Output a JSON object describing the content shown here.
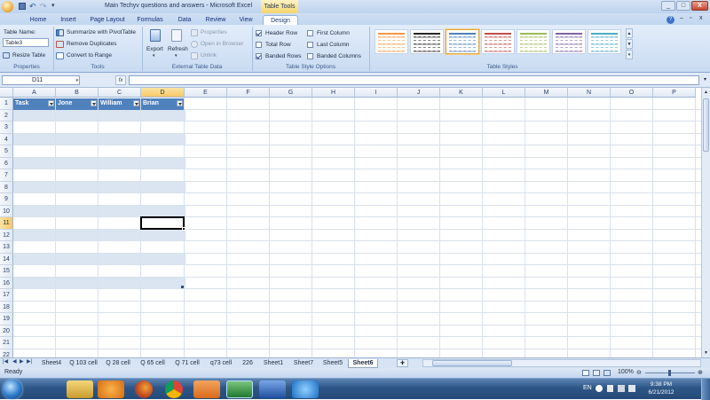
{
  "window": {
    "title": "Main Techyv questions and answers - Microsoft Excel",
    "context_tab": "Table Tools",
    "controls": [
      "_",
      "□",
      "X"
    ]
  },
  "ribbon_tabs": [
    "Home",
    "Insert",
    "Page Layout",
    "Formulas",
    "Data",
    "Review",
    "View",
    "Design"
  ],
  "active_tab": "Design",
  "properties": {
    "table_name_label": "Table Name:",
    "table_name_value": "Table3",
    "resize_label": "Resize Table",
    "group_label": "Properties"
  },
  "tools": {
    "summarize": "Summarize with PivotTable",
    "remove_duplicates": "Remove Duplicates",
    "convert": "Convert to Range",
    "group_label": "Tools"
  },
  "external": {
    "export": "Export",
    "refresh": "Refresh",
    "properties": "Properties",
    "open_browser": "Open in Browser",
    "unlink": "Unlink",
    "group_label": "External Table Data"
  },
  "style_options": {
    "header_row": {
      "label": "Header Row",
      "checked": true
    },
    "total_row": {
      "label": "Total Row",
      "checked": false
    },
    "banded_rows": {
      "label": "Banded Rows",
      "checked": true
    },
    "first_column": {
      "label": "First Column",
      "checked": false
    },
    "last_column": {
      "label": "Last Column",
      "checked": false
    },
    "banded_columns": {
      "label": "Banded Columns",
      "checked": false
    },
    "group_label": "Table Style Options"
  },
  "table_styles": {
    "group_label": "Table Styles",
    "swatches": [
      "#f79646",
      "#262626",
      "#4f81bd",
      "#c0504d",
      "#9bbb59",
      "#8064a2",
      "#4bacc6"
    ],
    "selected_index": 2
  },
  "formula_bar": {
    "name_box": "D11",
    "fx": "fx",
    "formula": ""
  },
  "columns": [
    "A",
    "B",
    "C",
    "D",
    "E",
    "F",
    "G",
    "H",
    "I",
    "J",
    "K",
    "L",
    "M",
    "N",
    "O",
    "P"
  ],
  "selected_column": "D",
  "rows": [
    "1",
    "2",
    "3",
    "4",
    "5",
    "6",
    "7",
    "8",
    "9",
    "10",
    "11",
    "12",
    "13",
    "14",
    "15",
    "16",
    "17",
    "18",
    "19",
    "20",
    "21",
    "22"
  ],
  "selected_row": "11",
  "table": {
    "headers": [
      "Task",
      "Jone",
      "William",
      "Brian"
    ],
    "header_color": "#4f81bd",
    "band_color": "#dbe5f1"
  },
  "sheet_tabs": [
    "Sheet4",
    "Q 103 cell",
    "Q 28 cell",
    "Q 65 cell",
    "Q 71 cell",
    "q73 cell",
    "226",
    "Sheet1",
    "Sheet7",
    "Sheet5",
    "Sheet6"
  ],
  "active_sheet": "Sheet6",
  "status": {
    "ready": "Ready",
    "zoom": "100%"
  },
  "taskbar": {
    "lang": "EN",
    "time": "9:38 PM",
    "date": "6/21/2012"
  }
}
